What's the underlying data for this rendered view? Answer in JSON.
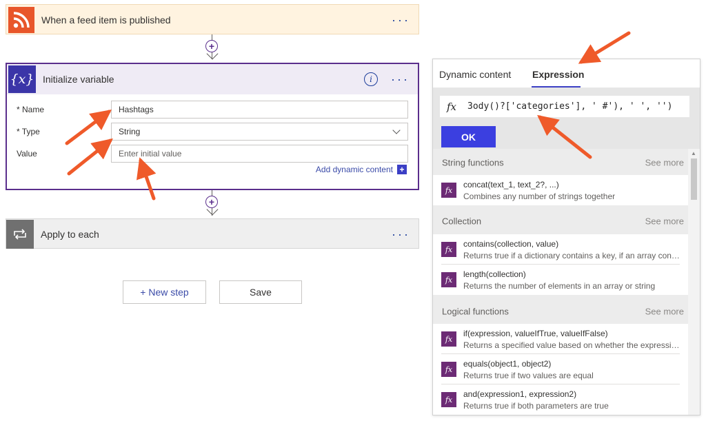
{
  "flow": {
    "trigger": {
      "title": "When a feed item is published",
      "more": "···",
      "icon": "rss-icon"
    },
    "initialize_variable": {
      "title": "Initialize variable",
      "more": "···",
      "info": "i",
      "icon_text": "{x}",
      "name_label": "* Name",
      "name_value": "Hashtags",
      "type_label": "* Type",
      "type_value": "String",
      "value_label": "Value",
      "value_placeholder": "Enter initial value",
      "add_dynamic": "Add dynamic content",
      "add_dynamic_plus": "+"
    },
    "apply_to_each": {
      "title": "Apply to each",
      "more": "···",
      "icon": "loop-icon"
    },
    "insert_plus": "+",
    "new_step": "+ New step",
    "save": "Save"
  },
  "panel": {
    "tabs": [
      "Dynamic content",
      "Expression"
    ],
    "active_tab": "Expression",
    "fx": "fx",
    "expression": "3ody()?['categories'], ' #'), ' ', '')",
    "ok": "OK",
    "see_more": "See more",
    "categories": [
      {
        "title": "String functions",
        "items": [
          {
            "name": "concat(text_1, text_2?, ...)",
            "desc": "Combines any number of strings together"
          }
        ]
      },
      {
        "title": "Collection",
        "items": [
          {
            "name": "contains(collection, value)",
            "desc": "Returns true if a dictionary contains a key, if an array cont..."
          },
          {
            "name": "length(collection)",
            "desc": "Returns the number of elements in an array or string"
          }
        ]
      },
      {
        "title": "Logical functions",
        "items": [
          {
            "name": "if(expression, valueIfTrue, valueIfFalse)",
            "desc": "Returns a specified value based on whether the expressio..."
          },
          {
            "name": "equals(object1, object2)",
            "desc": "Returns true if two values are equal"
          },
          {
            "name": "and(expression1, expression2)",
            "desc": "Returns true if both parameters are true"
          }
        ]
      }
    ]
  },
  "colors": {
    "accent": "#3b3fe0",
    "variable_purple": "#5a2e8c",
    "rss_orange": "#e8562a",
    "annotation_arrow": "#ef5a2a",
    "function_badge": "#6c2b75"
  }
}
